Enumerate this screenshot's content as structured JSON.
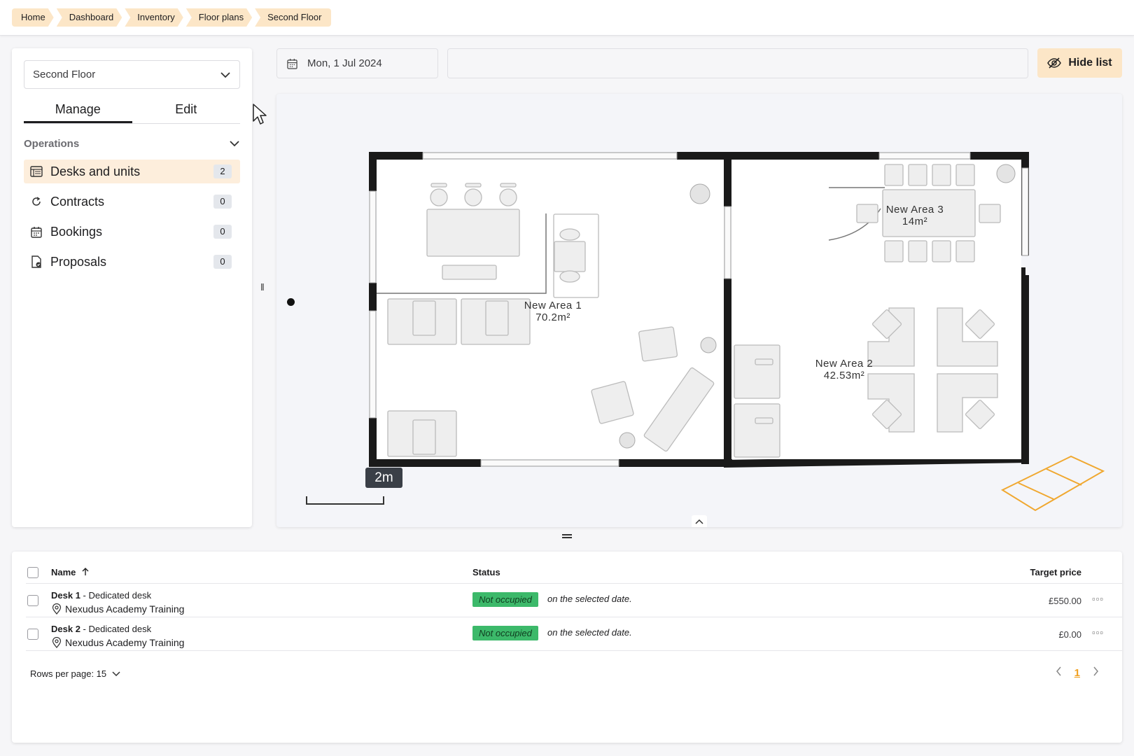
{
  "breadcrumbs": [
    "Home",
    "Dashboard",
    "Inventory",
    "Floor plans",
    "Second Floor"
  ],
  "floor_select": {
    "value": "Second Floor"
  },
  "tabs": [
    "Manage",
    "Edit"
  ],
  "operations": {
    "title": "Operations",
    "items": [
      {
        "label": "Desks and units",
        "count": "2",
        "icon": "table-list-icon"
      },
      {
        "label": "Contracts",
        "count": "0",
        "icon": "refresh-icon"
      },
      {
        "label": "Bookings",
        "count": "0",
        "icon": "calendar-icon"
      },
      {
        "label": "Proposals",
        "count": "0",
        "icon": "document-check-icon"
      }
    ]
  },
  "date_filter": {
    "value": "Mon, 1 Jul 2024"
  },
  "hide_list_label": "Hide list",
  "map": {
    "areas": [
      {
        "name": "New Area 1",
        "size": "70.2m²"
      },
      {
        "name": "New Area 2",
        "size": "42.53m²"
      },
      {
        "name": "New Area 3",
        "size": "14m²"
      }
    ],
    "scale_label": "2m"
  },
  "table": {
    "columns": {
      "name": "Name",
      "status": "Status",
      "price": "Target price"
    },
    "rows": [
      {
        "name": "Desk 1",
        "type": " - Dedicated desk",
        "location": "Nexudus Academy Training",
        "status": "Not occupied",
        "status_note": "on the selected date.",
        "price": "£550.00"
      },
      {
        "name": "Desk 2",
        "type": " - Dedicated desk",
        "location": "Nexudus Academy Training",
        "status": "Not occupied",
        "status_note": "on the selected date.",
        "price": "£0.00"
      }
    ],
    "rows_per_page": "Rows per page: 15",
    "current_page": "1"
  },
  "colors": {
    "accent": "#fce6c7",
    "status_green": "#3cb96a",
    "page_link": "#f0a020"
  }
}
